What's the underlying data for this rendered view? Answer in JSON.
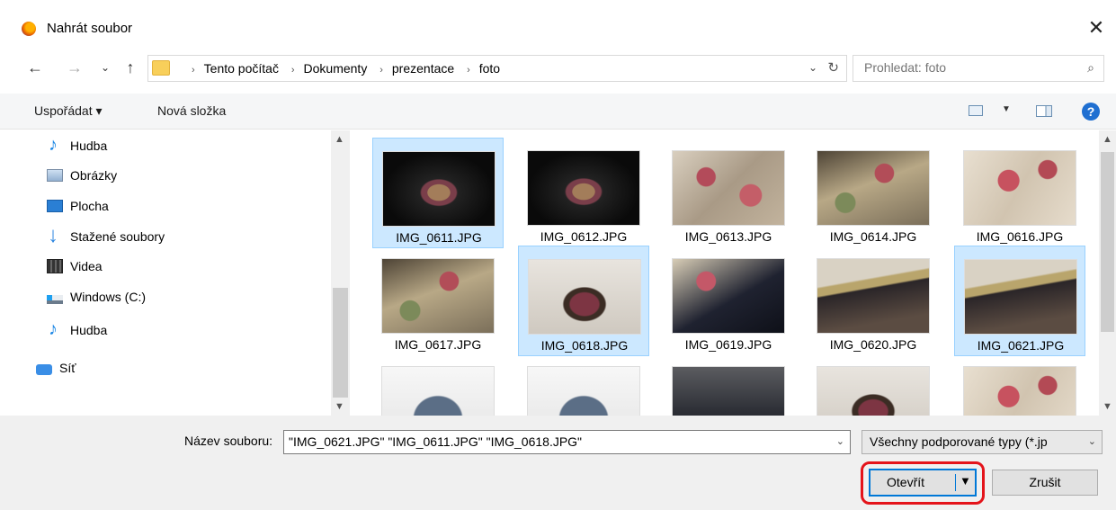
{
  "window": {
    "title": "Nahrát soubor",
    "close_glyph": "✕"
  },
  "nav": {
    "back": "←",
    "forward": "→",
    "recent": "⌄",
    "up": "↑"
  },
  "address": {
    "crumbs": [
      "Tento počítač",
      "Dokumenty",
      "prezentace",
      "foto"
    ],
    "separator": "›",
    "dropdown": "⌄",
    "refresh": "↻"
  },
  "search": {
    "placeholder": "Prohledat: foto",
    "icon": "⌕"
  },
  "toolbar": {
    "organize": "Uspořádat ▾",
    "new_folder": "Nová složka",
    "view_dropdown": "▼",
    "help": "?"
  },
  "sidebar": {
    "items": [
      {
        "label": "Hudba",
        "icon": "music-icon"
      },
      {
        "label": "Obrázky",
        "icon": "pictures-icon"
      },
      {
        "label": "Plocha",
        "icon": "desktop-icon"
      },
      {
        "label": "Stažené soubory",
        "icon": "downloads-icon"
      },
      {
        "label": "Videa",
        "icon": "videos-icon"
      },
      {
        "label": "Windows (C:)",
        "icon": "drive-icon"
      },
      {
        "label": "Hudba",
        "icon": "music-icon"
      },
      {
        "label": "Síť",
        "icon": "network-icon"
      }
    ]
  },
  "files": [
    {
      "name": "IMG_0611.JPG",
      "selected": true
    },
    {
      "name": "IMG_0612.JPG",
      "selected": false
    },
    {
      "name": "IMG_0613.JPG",
      "selected": false
    },
    {
      "name": "IMG_0614.JPG",
      "selected": false
    },
    {
      "name": "IMG_0616.JPG",
      "selected": false
    },
    {
      "name": "IMG_0617.JPG",
      "selected": false
    },
    {
      "name": "IMG_0618.JPG",
      "selected": true
    },
    {
      "name": "IMG_0619.JPG",
      "selected": false
    },
    {
      "name": "IMG_0620.JPG",
      "selected": false
    },
    {
      "name": "IMG_0621.JPG",
      "selected": true
    }
  ],
  "footer": {
    "filename_label": "Název souboru:",
    "filename_value": "\"IMG_0621.JPG\" \"IMG_0611.JPG\" \"IMG_0618.JPG\"",
    "filetype_value": "Všechny podporované typy (*.jp",
    "open_label": "Otevřít",
    "open_arrow": "▼",
    "cancel_label": "Zrušit",
    "dropdown": "⌄"
  },
  "colors": {
    "selection": "#cce8ff",
    "accent": "#0078d7",
    "annotation": "#e4141b"
  }
}
